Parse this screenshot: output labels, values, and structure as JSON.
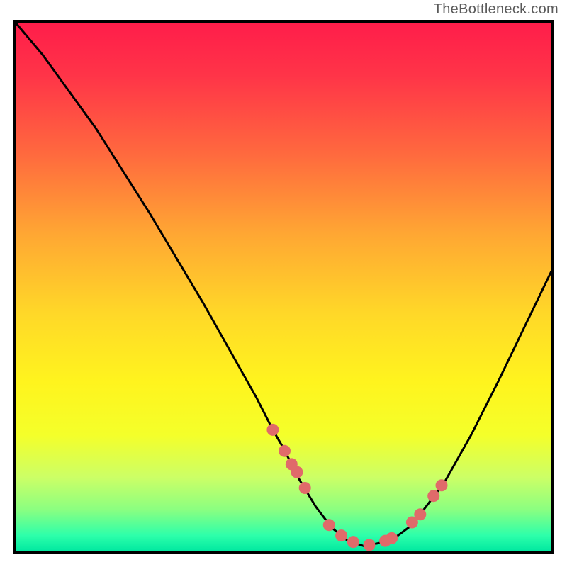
{
  "attribution": "TheBottleneck.com",
  "chart_data": {
    "type": "line",
    "title": "",
    "xlabel": "",
    "ylabel": "",
    "xlim": [
      0,
      100
    ],
    "ylim": [
      0,
      100
    ],
    "series": [
      {
        "name": "curve",
        "x": [
          0,
          5,
          10,
          15,
          20,
          25,
          30,
          35,
          40,
          45,
          48,
          50,
          53,
          56,
          59,
          62,
          65,
          70,
          74,
          80,
          85,
          90,
          95,
          100
        ],
        "y": [
          100,
          94,
          87,
          80,
          72,
          64,
          55.5,
          47,
          38,
          29,
          23,
          19.5,
          13.5,
          8.5,
          4.5,
          2,
          1,
          2,
          5,
          13,
          22,
          32,
          42.5,
          53
        ]
      }
    ],
    "markers": {
      "name": "dots",
      "x": [
        48,
        50.2,
        51.5,
        52.5,
        54,
        58.5,
        60.8,
        63,
        66,
        69,
        70.2,
        74,
        75.5,
        78,
        79.5
      ],
      "y": [
        23,
        19,
        16.5,
        15,
        12,
        5,
        3,
        1.8,
        1.2,
        2,
        2.5,
        5.5,
        7,
        10.5,
        12.5
      ]
    },
    "gradient_stops": [
      {
        "offset": 0.0,
        "color": "#ff1d4a"
      },
      {
        "offset": 0.1,
        "color": "#ff3448"
      },
      {
        "offset": 0.25,
        "color": "#ff6a3e"
      },
      {
        "offset": 0.4,
        "color": "#ffa733"
      },
      {
        "offset": 0.55,
        "color": "#ffd828"
      },
      {
        "offset": 0.68,
        "color": "#fff41e"
      },
      {
        "offset": 0.78,
        "color": "#f4ff2a"
      },
      {
        "offset": 0.86,
        "color": "#ccff66"
      },
      {
        "offset": 0.92,
        "color": "#8cff80"
      },
      {
        "offset": 0.97,
        "color": "#2dffaa"
      },
      {
        "offset": 1.0,
        "color": "#00e8a0"
      }
    ],
    "curve_stroke": "#000000",
    "marker_color": "#e06a6a",
    "grid": false,
    "legend": false
  }
}
